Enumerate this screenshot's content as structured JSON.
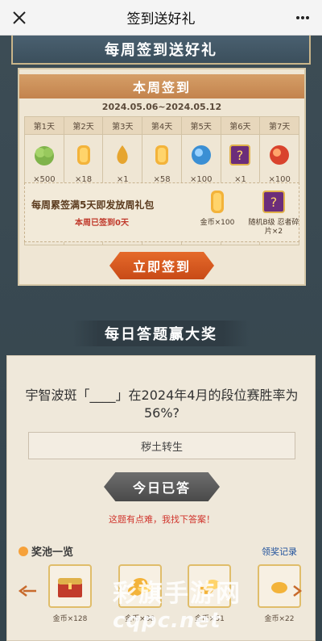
{
  "titlebar": {
    "title": "签到送好礼"
  },
  "weekly": {
    "header": "每周签到送好礼",
    "banner": "本周签到",
    "date_range": "2024.05.06~2024.05.12",
    "days": [
      {
        "label": "第1天",
        "count": "×500",
        "icon": "cabbage-icon"
      },
      {
        "label": "第2天",
        "count": "×18",
        "icon": "coin-stack-icon"
      },
      {
        "label": "第3天",
        "count": "×1",
        "icon": "gold-drop-icon"
      },
      {
        "label": "第4天",
        "count": "×58",
        "icon": "coin-stack-icon"
      },
      {
        "label": "第5天",
        "count": "×100",
        "icon": "blue-orb-icon"
      },
      {
        "label": "第6天",
        "count": "×1",
        "icon": "mystery-shard-icon"
      },
      {
        "label": "第7天",
        "count": "×100",
        "icon": "red-orb-icon"
      }
    ],
    "bonus": {
      "title": "每周累签满5天即发放周礼包",
      "progress_prefix": "本周已签到",
      "progress_value": "0",
      "progress_suffix": "天",
      "rewards": [
        {
          "label": "金币×100",
          "icon": "coin-stack-icon"
        },
        {
          "label": "随机B级 忍者碎片×2",
          "icon": "mystery-shard-icon"
        }
      ]
    },
    "checkin_button": "立即签到"
  },
  "quiz": {
    "banner": "每日答题赢大奖",
    "question": "宇智波斑「____」在2024年4月的段位赛胜率为56%?",
    "answer": "秽土转生",
    "answered_button": "今日已答",
    "hint": "这题有点难，我找下答案！",
    "pool_title": "奖池一览",
    "pool_record": "领奖记录",
    "pool_items": [
      {
        "label": "金币×128",
        "icon": "treasure-chest-icon"
      },
      {
        "label": "金币×88",
        "icon": "coin-pile-icon"
      },
      {
        "label": "金币×51",
        "icon": "coin-pile-icon"
      },
      {
        "label": "金币×22",
        "icon": "coin-pile-icon"
      }
    ]
  },
  "watermark": {
    "line1": "彩旗手游网",
    "line2": "cqpc.net"
  }
}
